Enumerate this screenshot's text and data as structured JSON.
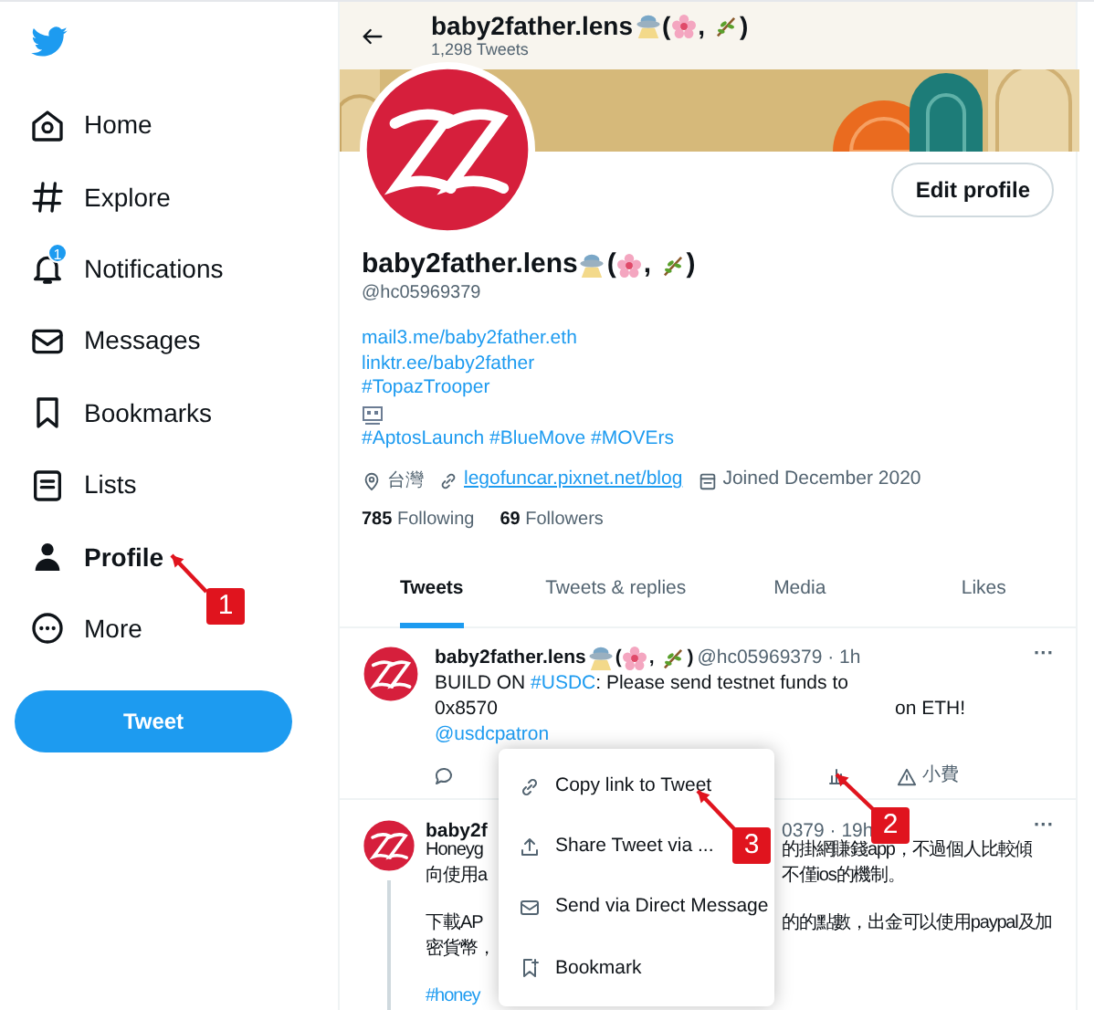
{
  "sidebar": {
    "items": [
      {
        "kind": "home",
        "label": "Home",
        "selected": false
      },
      {
        "kind": "explore",
        "label": "Explore",
        "selected": false
      },
      {
        "kind": "bell",
        "label": "Notifications",
        "selected": false,
        "badge": "1"
      },
      {
        "kind": "mail",
        "label": "Messages",
        "selected": false
      },
      {
        "kind": "bookmark",
        "label": "Bookmarks",
        "selected": false
      },
      {
        "kind": "list",
        "label": "Lists",
        "selected": false
      },
      {
        "kind": "person",
        "label": "Profile",
        "selected": true
      },
      {
        "kind": "more",
        "label": "More",
        "selected": false
      }
    ],
    "tweet_button": "Tweet"
  },
  "header": {
    "name": "baby2father.lens",
    "name_punctuation": [
      "(",
      ", ",
      ")"
    ],
    "tweet_count": "1,298 Tweets"
  },
  "profile": {
    "edit_button": "Edit profile",
    "name": "baby2father.lens",
    "name_punctuation": [
      "(",
      ", ",
      ")"
    ],
    "handle": "@hc05969379",
    "bio_lines": [
      "mail3.me/baby2father.eth",
      "linktr.ee/baby2father",
      "#TopazTrooper",
      "#AptosLaunch #BlueMove #MOVErs"
    ],
    "location": "台灣",
    "website": "legofuncar.pixnet.net/blog",
    "joined": "Joined December 2020",
    "following_count": "785",
    "following_label": "Following",
    "followers_count": "69",
    "followers_label": "Followers"
  },
  "tabs": [
    {
      "label": "Tweets",
      "selected": true
    },
    {
      "label": "Tweets & replies",
      "selected": false
    },
    {
      "label": "Media",
      "selected": false
    },
    {
      "label": "Likes",
      "selected": false
    }
  ],
  "tweet_1": {
    "name": "baby2father.lens",
    "name_punctuation": [
      "(",
      ", ",
      ")"
    ],
    "meta": "@hc05969379 · 1h",
    "text_start": "BUILD ON ",
    "hashtag": "#USDC",
    "text_end": ": Please send testnet funds to",
    "address": "0x8570",
    "address_end": "on ETH!",
    "mention": "@usdcpatron",
    "tip_label": "小費",
    "more": "···"
  },
  "tweet_2": {
    "name": "baby2f",
    "meta": "0379 · 19h",
    "more": "···",
    "paragraphs": [
      [
        {
          "left": "Honeyg",
          "right": "的掛網賺錢app，不過個人比較傾"
        },
        {
          "left": "向使用a",
          "right": "不僅ios的機制。"
        }
      ],
      [
        {
          "left": "下載AP",
          "right": "的的點數，出金可以使用paypal及加"
        },
        {
          "left": "密貨幣，"
        }
      ],
      [
        {
          "left": "#honey"
        }
      ]
    ]
  },
  "menu": {
    "items": [
      {
        "kind": "link",
        "label": "Copy link to Tweet"
      },
      {
        "kind": "share",
        "label": "Share Tweet via ..."
      },
      {
        "kind": "mail",
        "label": "Send via Direct Message"
      },
      {
        "kind": "bookmark",
        "label": "Bookmark"
      }
    ]
  },
  "annotations": [
    {
      "label": "1"
    },
    {
      "label": "2"
    },
    {
      "label": "3"
    }
  ]
}
